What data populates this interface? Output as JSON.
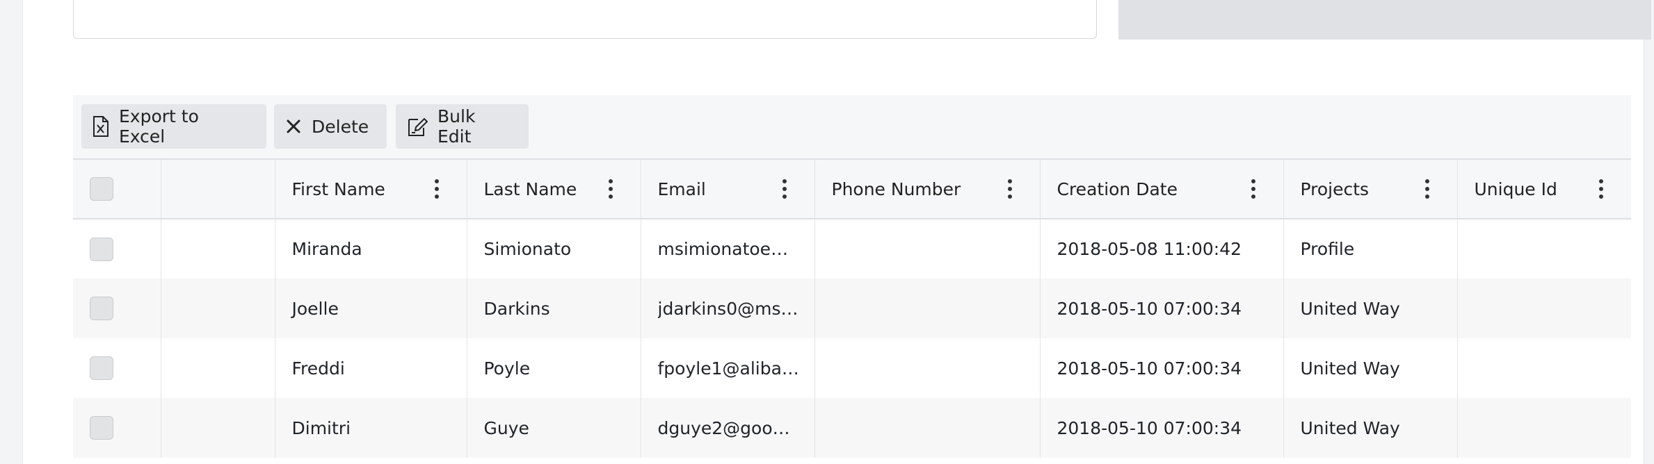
{
  "toolbar": {
    "export_label": "Export to Excel",
    "delete_label": "Delete",
    "bulk_edit_label": "Bulk Edit"
  },
  "table": {
    "columns": [
      {
        "label": "First Name"
      },
      {
        "label": "Last Name"
      },
      {
        "label": "Email"
      },
      {
        "label": "Phone Number"
      },
      {
        "label": "Creation Date"
      },
      {
        "label": "Projects"
      },
      {
        "label": "Unique Id"
      }
    ],
    "rows": [
      {
        "first_name": "Miranda",
        "last_name": "Simionato",
        "email": "msimionatoe@…",
        "phone": "",
        "created": "2018-05-08 11:00:42",
        "projects": "Profile",
        "unique_id": ""
      },
      {
        "first_name": "Joelle",
        "last_name": "Darkins",
        "email": "jdarkins0@ms…",
        "phone": "",
        "created": "2018-05-10 07:00:34",
        "projects": "United Way",
        "unique_id": ""
      },
      {
        "first_name": "Freddi",
        "last_name": "Poyle",
        "email": "fpoyle1@alibab…",
        "phone": "",
        "created": "2018-05-10 07:00:34",
        "projects": "United Way",
        "unique_id": ""
      },
      {
        "first_name": "Dimitri",
        "last_name": "Guye",
        "email": "dguye2@googl…",
        "phone": "",
        "created": "2018-05-10 07:00:34",
        "projects": "United Way",
        "unique_id": ""
      }
    ]
  },
  "colors": {
    "toolbar_bg": "#f6f7f8",
    "button_bg": "#e4e6e9",
    "row_alt_bg": "#f7f7f7"
  },
  "icons": {
    "export": "excel-file-icon",
    "delete": "close-icon",
    "bulk_edit": "edit-document-icon",
    "column_menu": "kebab-menu-icon"
  }
}
